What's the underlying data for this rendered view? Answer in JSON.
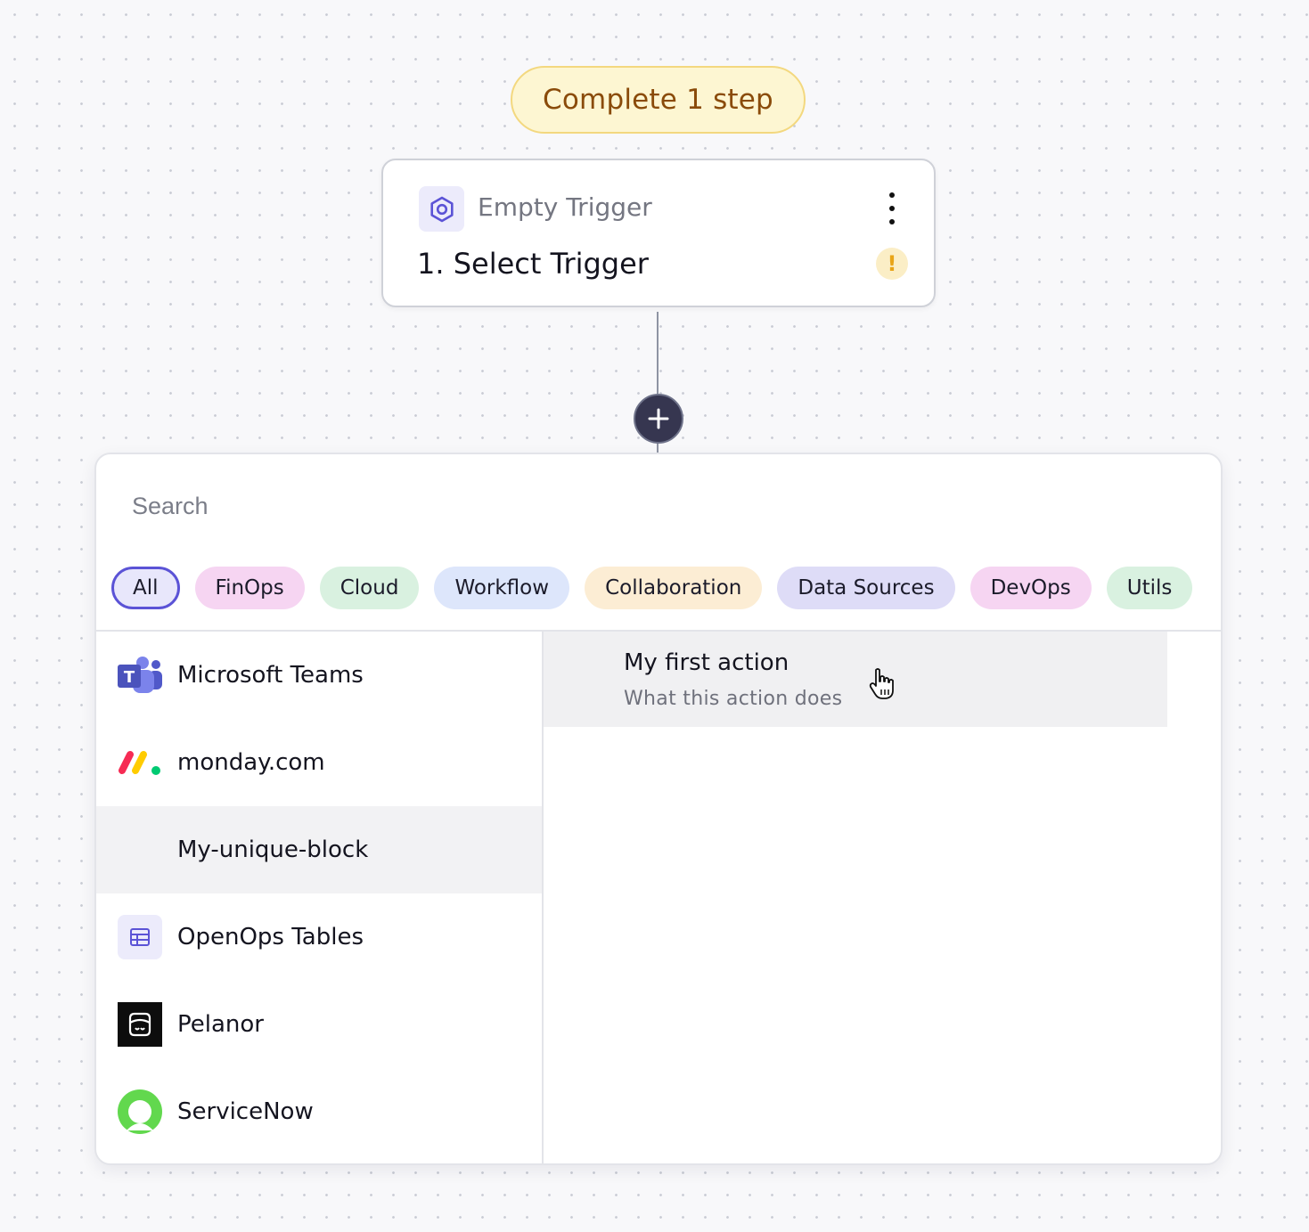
{
  "banner": {
    "text": "Complete 1 step"
  },
  "trigger": {
    "type_label": "Empty Trigger",
    "title": "1. Select Trigger",
    "warning_symbol": "!"
  },
  "search": {
    "placeholder": "Search",
    "value": ""
  },
  "categories": [
    {
      "label": "All",
      "color": "#e8e7fb",
      "selected": true
    },
    {
      "label": "FinOps",
      "color": "#f6d5f2"
    },
    {
      "label": "Cloud",
      "color": "#d9f1e0"
    },
    {
      "label": "Workflow",
      "color": "#dde6fb"
    },
    {
      "label": "Collaboration",
      "color": "#fcedd4"
    },
    {
      "label": "Data Sources",
      "color": "#dedcf7"
    },
    {
      "label": "DevOps",
      "color": "#f6d5f2"
    },
    {
      "label": "Utils",
      "color": "#d9f1e0"
    }
  ],
  "blocks": [
    {
      "name": "Microsoft Teams",
      "icon": "microsoft-teams-icon"
    },
    {
      "name": "monday.com",
      "icon": "monday-icon"
    },
    {
      "name": "My-unique-block",
      "icon": ""
    },
    {
      "name": "OpenOps Tables",
      "icon": "table-icon"
    },
    {
      "name": "Pelanor",
      "icon": "pelanor-icon"
    },
    {
      "name": "ServiceNow",
      "icon": "servicenow-icon"
    }
  ],
  "actions": [
    {
      "title": "My first action",
      "description": "What this action does"
    }
  ],
  "colors": {
    "accent": "#5b53d6",
    "banner_text": "#8a4b0a",
    "add_button": "#363650",
    "warning": "#e8a417"
  }
}
